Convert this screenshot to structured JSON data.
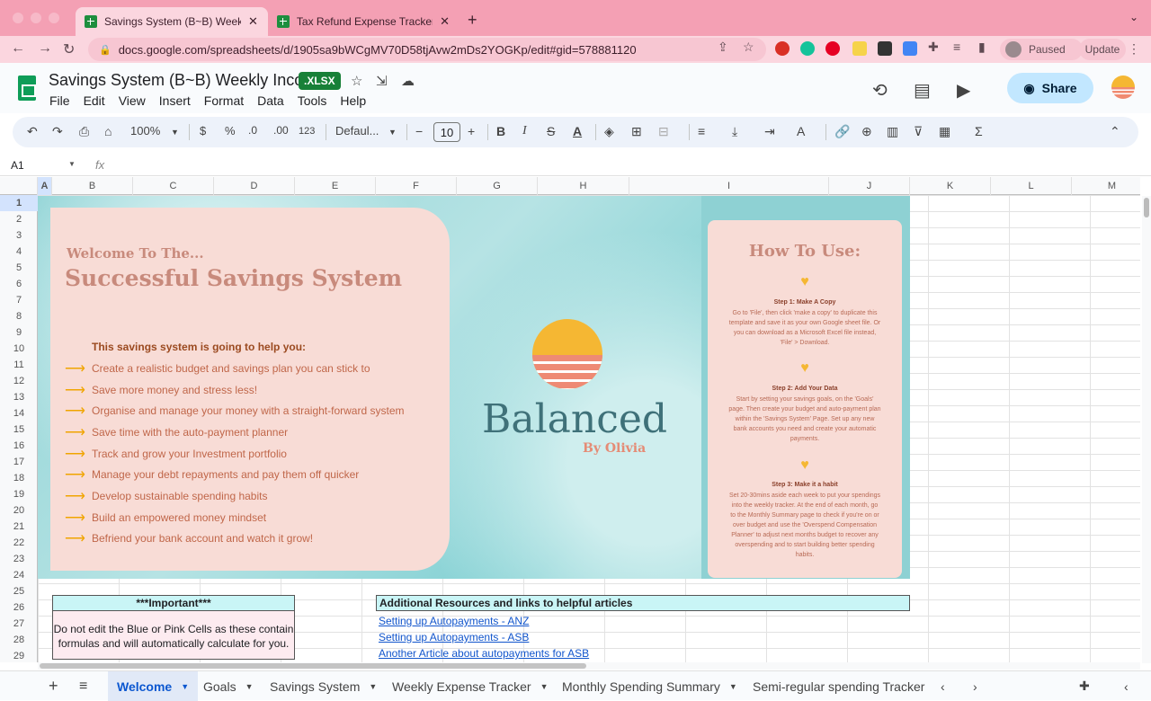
{
  "browser": {
    "tabs": [
      {
        "title": "Savings System (B~B) Weekly",
        "active": true
      },
      {
        "title": "Tax Refund Expense Tracker.xl",
        "active": false
      }
    ],
    "url": "docs.google.com/spreadsheets/d/1905sa9bWCgMV70D58tjAvw2mDs2YOGKp/edit#gid=578881120",
    "profile_status": "Paused",
    "update_label": "Update"
  },
  "doc": {
    "title": "Savings System (B~B) Weekly Income",
    "badge": ".XLSX",
    "menus": [
      "File",
      "Edit",
      "View",
      "Insert",
      "Format",
      "Data",
      "Tools",
      "Help"
    ],
    "share_label": "Share"
  },
  "toolbar": {
    "zoom": "100%",
    "currency": "$",
    "percent": "%",
    "dec_less": ".0",
    "dec_more": ".00",
    "number_format": "123",
    "font": "Defaul...",
    "font_size": "10"
  },
  "formula_bar": {
    "cell_ref": "A1",
    "fx": "fx"
  },
  "columns": [
    "A",
    "B",
    "C",
    "D",
    "E",
    "F",
    "G",
    "H",
    "I",
    "J",
    "K",
    "L",
    "M"
  ],
  "rows": [
    "1",
    "2",
    "3",
    "4",
    "5",
    "6",
    "7",
    "8",
    "9",
    "10",
    "11",
    "12",
    "13",
    "14",
    "15",
    "16",
    "17",
    "18",
    "19",
    "20",
    "21",
    "22",
    "23",
    "24",
    "25",
    "26",
    "27",
    "28",
    "29"
  ],
  "banner": {
    "welcome_small": "Welcome To The...",
    "welcome_big": "Successful Savings System",
    "helps_heading": "This savings system is going to help you:",
    "bullets": [
      "Create a realistic budget and savings plan you can stick to",
      "Save more money and stress less!",
      "Organise and manage your money with a straight-forward system",
      "Save time with the auto-payment planner",
      "Track and grow your Investment portfolio",
      "Manage your debt repayments and pay them off quicker",
      "Develop sustainable spending habits",
      "Build an empowered money mindset",
      "Befriend your bank account and watch it grow!"
    ],
    "brand": "Balanced",
    "byline": "By Olivia"
  },
  "how_to": {
    "title": "How To Use:",
    "steps": [
      {
        "heading": "Step 1: Make A Copy",
        "body": "Go to 'File', then click 'make a copy' to duplicate this template and save it as your own Google sheet file. Or you can download as a Microsoft Excel file instead, 'File' > Download."
      },
      {
        "heading": "Step 2: Add Your Data",
        "body": "Start by setting your savings goals, on the 'Goals' page. Then create your budget and auto-payment plan within the 'Savings System' Page. Set up any new bank accounts you need and create your automatic payments."
      },
      {
        "heading": "Step 3: Make it a habit",
        "body": "Set 20-30mins aside each week to put your spendings into the weekly tracker. At the end of each month, go to the Monthly Summary page to check if you're on or over budget and use the 'Overspend Compensation Planner' to adjust next months budget to recover any overspending and to start building better spending habits."
      }
    ]
  },
  "important": {
    "heading": "***Important***",
    "body": "Do not edit the Blue or Pink Cells as these contain formulas and will automatically calculate for you."
  },
  "resources": {
    "heading": "Additional Resources and links to helpful articles",
    "links": [
      "Setting up Autopayments - ANZ",
      "Setting up Autopayments - ASB",
      "Another Article about autopayments for ASB"
    ]
  },
  "sheet_tabs": [
    "Welcome",
    "Goals",
    "Savings System",
    "Weekly Expense Tracker",
    "Monthly Spending Summary",
    "Semi-regular spending Tracker"
  ],
  "colors": {
    "tab_strip": "#f4a0b4",
    "accent_pink": "#f8dcd6",
    "accent_teal": "#8fd3d5",
    "link": "#1155cc"
  }
}
